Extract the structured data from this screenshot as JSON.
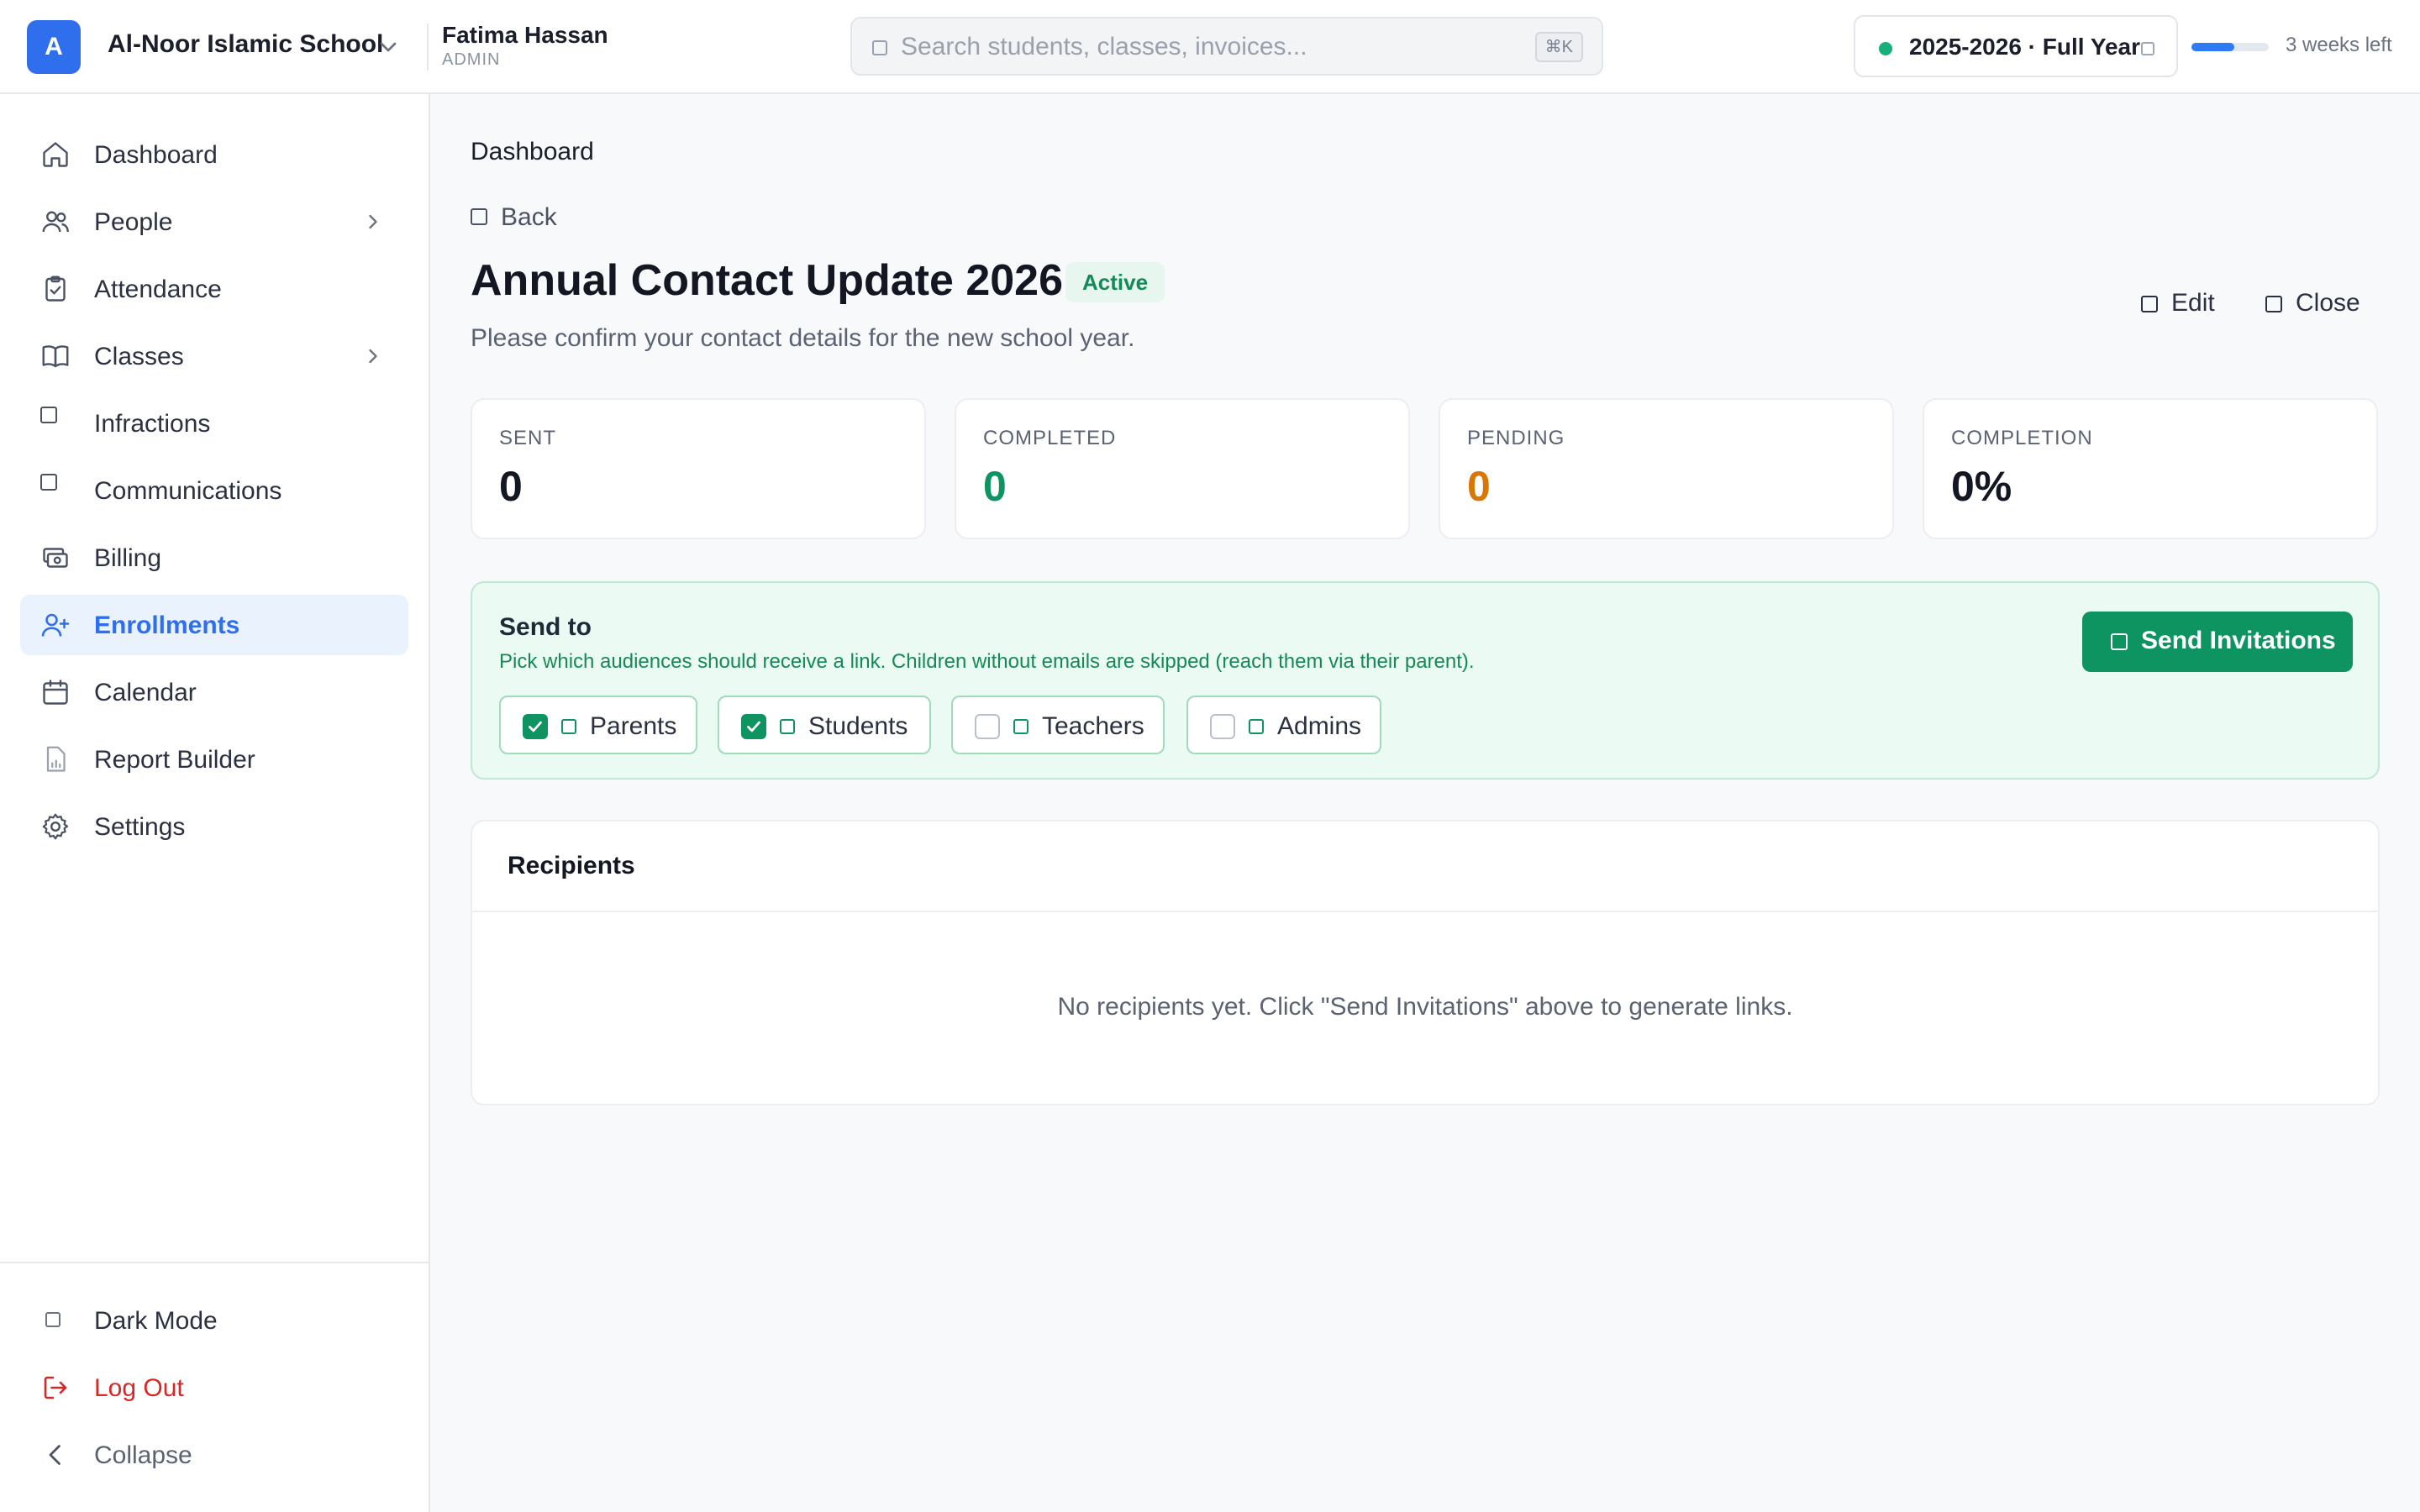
{
  "header": {
    "logo_letter": "A",
    "school_name": "Al-Noor Islamic School",
    "user_name": "Fatima Hassan",
    "user_role": "ADMIN",
    "search_placeholder": "Search students, classes, invoices...",
    "search_shortcut": "⌘K",
    "year_label": "2025-2026 · Full Year",
    "year_status_color": "#16b07a",
    "term_progress_percent": 55,
    "weeks_left": "3 weeks left"
  },
  "sidebar": {
    "items": [
      {
        "label": "Dashboard",
        "icon": "home-icon"
      },
      {
        "label": "People",
        "icon": "people-icon",
        "has_submenu": true
      },
      {
        "label": "Attendance",
        "icon": "clipboard-check-icon"
      },
      {
        "label": "Classes",
        "icon": "book-icon",
        "has_submenu": true
      },
      {
        "label": "Infractions",
        "icon": "square-icon"
      },
      {
        "label": "Communications",
        "icon": "square-icon"
      },
      {
        "label": "Billing",
        "icon": "cash-icon"
      },
      {
        "label": "Enrollments",
        "icon": "user-plus-icon",
        "active": true
      },
      {
        "label": "Calendar",
        "icon": "calendar-icon"
      },
      {
        "label": "Report Builder",
        "icon": "report-icon"
      },
      {
        "label": "Settings",
        "icon": "gear-icon"
      }
    ],
    "bottom": {
      "dark_mode": "Dark Mode",
      "log_out": "Log Out",
      "collapse": "Collapse"
    }
  },
  "main": {
    "breadcrumb": "Dashboard",
    "back_label": "Back",
    "title": "Annual Contact Update 2026",
    "status": "Active",
    "subtitle": "Please confirm your contact details for the new school year.",
    "actions": {
      "edit": "Edit",
      "close": "Close"
    },
    "stats": [
      {
        "label": "SENT",
        "value": "0",
        "color": "#121722"
      },
      {
        "label": "COMPLETED",
        "value": "0",
        "color": "#0e9461"
      },
      {
        "label": "PENDING",
        "value": "0",
        "color": "#d97706"
      },
      {
        "label": "COMPLETION",
        "value": "0%",
        "color": "#121722"
      }
    ],
    "send_to": {
      "title": "Send to",
      "help": "Pick which audiences should receive a link. Children without emails are skipped (reach them via their parent).",
      "button": "Send Invitations",
      "audiences": [
        {
          "label": "Parents",
          "checked": true
        },
        {
          "label": "Students",
          "checked": true
        },
        {
          "label": "Teachers",
          "checked": false
        },
        {
          "label": "Admins",
          "checked": false
        }
      ]
    },
    "recipients": {
      "title": "Recipients",
      "empty_message": "No recipients yet. Click \"Send Invitations\" above to generate links."
    }
  }
}
